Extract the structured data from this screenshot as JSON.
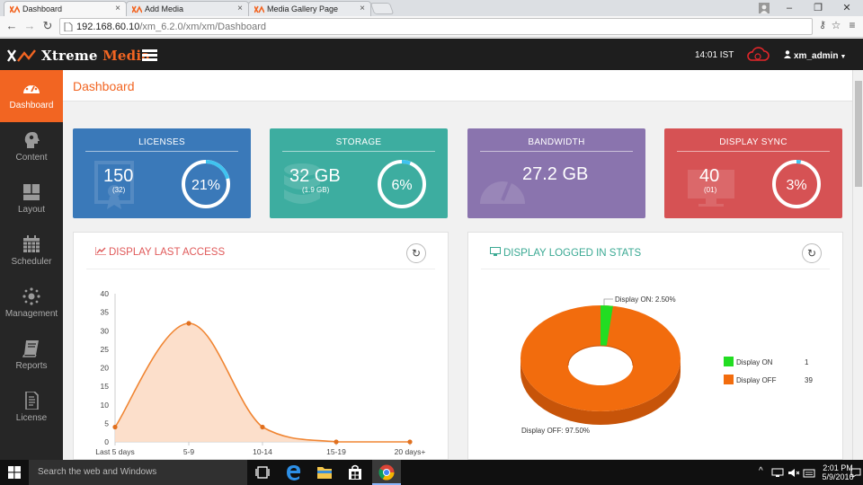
{
  "browser": {
    "tabs": [
      {
        "label": "Dashboard"
      },
      {
        "label": "Add Media"
      },
      {
        "label": "Media Gallery Page"
      }
    ],
    "url_host": "192.168.60.10",
    "url_path": "/xm_6.2.0/xm/xm/Dashboard"
  },
  "header": {
    "brand_white": "Xtreme",
    "brand_orange": "Media",
    "time": "14:01 IST",
    "user": "xm_admin"
  },
  "sidebar": {
    "items": [
      {
        "label": "Dashboard",
        "icon": "gauge-icon"
      },
      {
        "label": "Content",
        "icon": "head-icon"
      },
      {
        "label": "Layout",
        "icon": "layout-icon"
      },
      {
        "label": "Scheduler",
        "icon": "calendar-icon"
      },
      {
        "label": "Management",
        "icon": "network-icon"
      },
      {
        "label": "Reports",
        "icon": "book-icon"
      },
      {
        "label": "License",
        "icon": "document-icon"
      }
    ]
  },
  "page": {
    "title": "Dashboard"
  },
  "cards": {
    "licenses": {
      "title": "LICENSES",
      "value": "150",
      "sub": "(32)",
      "percent_label": "21%",
      "percent": 21,
      "color": "#3a79b9"
    },
    "storage": {
      "title": "STORAGE",
      "value": "32 GB",
      "sub": "(1.9 GB)",
      "percent_label": "6%",
      "percent": 6,
      "color": "#3dada0"
    },
    "bandwidth": {
      "title": "BANDWIDTH",
      "value": "27.2 GB",
      "color": "#8a74ae"
    },
    "display_sync": {
      "title": "DISPLAY SYNC",
      "value": "40",
      "sub": "(01)",
      "percent_label": "3%",
      "percent": 3,
      "color": "#d65254"
    }
  },
  "panels": {
    "last_access": {
      "title": "DISPLAY LAST ACCESS",
      "color": "#e05a5a"
    },
    "logged_in": {
      "title": "DISPLAY LOGGED IN STATS",
      "color": "#3aa993"
    }
  },
  "chart_data": [
    {
      "type": "area",
      "categories": [
        "Last 5 days",
        "5-9",
        "10-14",
        "15-19",
        "20 days+"
      ],
      "values": [
        4,
        32,
        4,
        0,
        0
      ],
      "ylim": [
        0,
        40
      ],
      "yticks": [
        0,
        5,
        10,
        15,
        20,
        25,
        30,
        35,
        40
      ],
      "grid": false,
      "color": "#f08532"
    },
    {
      "type": "pie",
      "style": "3d-donut",
      "slices": [
        {
          "name": "Display ON",
          "value": 1,
          "label": "Display ON: 2.50%",
          "color": "#22dd22"
        },
        {
          "name": "Display OFF",
          "value": 39,
          "label": "Display OFF: 97.50%",
          "color": "#f26c0d"
        }
      ],
      "legend_position": "right"
    }
  ],
  "taskbar": {
    "search_placeholder": "Search the web and Windows",
    "time": "2:01 PM",
    "date": "5/9/2016"
  }
}
